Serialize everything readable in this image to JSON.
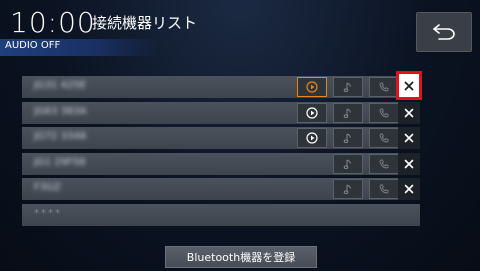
{
  "header": {
    "time": "10:00",
    "title": "接続機器リスト",
    "audio_status": "AUDIO OFF"
  },
  "devices": [
    {
      "name": "JG31 425E",
      "audio_active": true,
      "close_selected": true
    },
    {
      "name": "JG63 383A",
      "audio_active": false,
      "close_selected": false
    },
    {
      "name": "JG72 3348",
      "audio_active": false,
      "close_selected": false
    },
    {
      "name": "JG1 29F58",
      "audio_active": false,
      "close_selected": false
    },
    {
      "name": "F3GZ",
      "audio_active": false,
      "close_selected": false
    }
  ],
  "empty_slot": "****",
  "register_button": "Bluetooth機器を登録",
  "colors": {
    "accent_orange": "#e8841c",
    "selection_red": "#e0121a",
    "audio_bar": "#1f3f7e"
  },
  "icons": {
    "back": "return-arrow-icon",
    "audio": "play-circle-icon",
    "music": "music-note-icon",
    "phone": "phone-icon",
    "close": "close-x-icon"
  }
}
